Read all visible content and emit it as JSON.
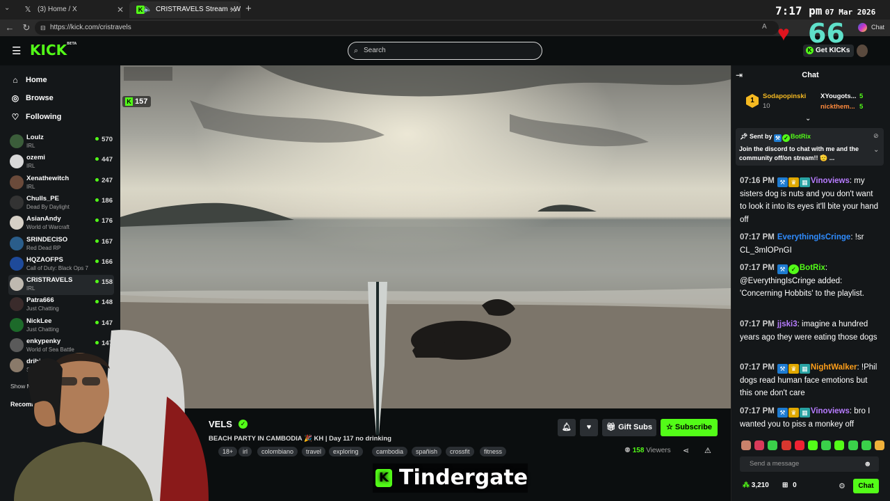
{
  "browser": {
    "tabs": [
      {
        "label": "(3) Home / X",
        "icon": "x-logo-icon"
      },
      {
        "label": "CRISTRAVELS Stream - Watch",
        "icon": "kick-logo-icon"
      }
    ],
    "url": "https://kick.com/cristravels",
    "clock": {
      "time": "7:17 pm",
      "date": "07 Mar 2026"
    },
    "chat_button": "Chat"
  },
  "overlay": {
    "heart_count": "66",
    "banner": "Tindergate"
  },
  "header": {
    "logo": "KICK",
    "logo_sup": "BETA",
    "search_placeholder": "Search",
    "get_kicks": "Get KICKs"
  },
  "sidebar": {
    "nav": [
      {
        "label": "Home",
        "icon": "home-icon"
      },
      {
        "label": "Browse",
        "icon": "compass-icon"
      },
      {
        "label": "Following",
        "icon": "heart-icon"
      }
    ],
    "channels": [
      {
        "name": "Loulz",
        "game": "IRL",
        "viewers": "570"
      },
      {
        "name": "ozemi",
        "game": "IRL",
        "viewers": "447"
      },
      {
        "name": "Xenathewitch",
        "game": "IRL",
        "viewers": "247"
      },
      {
        "name": "Chulls_PE",
        "game": "Dead By Daylight",
        "viewers": "186"
      },
      {
        "name": "AsianAndy",
        "game": "World of Warcraft",
        "viewers": "176"
      },
      {
        "name": "SRINDECISO",
        "game": "Red Dead RP",
        "viewers": "167"
      },
      {
        "name": "HQZAOFPS",
        "game": "Call of Duty: Black Ops 7",
        "viewers": "166"
      },
      {
        "name": "CRISTRAVELS",
        "game": "IRL",
        "viewers": "158"
      },
      {
        "name": "Patra666",
        "game": "Just Chatting",
        "viewers": "148"
      },
      {
        "name": "NickLee",
        "game": "Just Chatting",
        "viewers": "147"
      },
      {
        "name": "enkypenky",
        "game": "World of Sea Battle",
        "viewers": "147"
      },
      {
        "name": "dribina",
        "game": "Stumble Guys",
        "viewers": ""
      }
    ],
    "show_more": "Show More",
    "recommended": "Recommended"
  },
  "player": {
    "viewer_count": "157"
  },
  "stream": {
    "channel": "CRISTRAVELS",
    "channel_visible": "VELS",
    "title": "BEACH PARTY IN CAMBODIA 🎉 KH  | Day 117 no drinking",
    "tags": [
      "18+",
      "irl",
      "colombiano",
      "travel",
      "exploring",
      "cambodia",
      "spañish",
      "crossfit",
      "fitness"
    ],
    "viewers_count": "158",
    "viewers_label": "Viewers",
    "buttons": {
      "gift": "Gift Subs",
      "subscribe": "Subscribe"
    }
  },
  "chat": {
    "title": "Chat",
    "gifters": [
      {
        "name": "Sodapopinski",
        "count": "10",
        "rank": "1"
      },
      {
        "name": "XYougots...",
        "count": "5"
      },
      {
        "name": "nickthem...",
        "count": "5"
      }
    ],
    "pinned": {
      "sent_by_label": "Sent by",
      "sender": "BotRix",
      "text": "Join the discord to chat with me and the community off/on stream!! 🫡 ..."
    },
    "messages": [
      {
        "time": "07:16 PM",
        "user": "Vinoviews",
        "color": "#b77cff",
        "text": "my sisters dog is nuts and you don't want to look it into its eyes it'll bite your hand off"
      },
      {
        "time": "07:17 PM",
        "user": "EverythingIsCringe",
        "color": "#2f8cff",
        "text": "!sr CL_3mlOPnGI"
      },
      {
        "time": "07:17 PM",
        "user": "BotRix",
        "color": "#53fc18",
        "text": "@EverythingIsCringe added: 'Concerning Hobbits' to the playlist."
      },
      {
        "time": "07:17 PM",
        "user": "jjski3",
        "color": "#b77cff",
        "text": "imagine a hundred years ago they were eating those dogs"
      },
      {
        "time": "07:17 PM",
        "user": "NightWalker",
        "color": "#ff9f1a",
        "text": "!Phil dogs read human face emotions but this one don't care"
      },
      {
        "time": "07:17 PM",
        "user": "Vinoviews",
        "color": "#b77cff",
        "text": "bro I wanted you to piss a monkey off"
      }
    ],
    "input_placeholder": "Send a message",
    "points": "3,210",
    "gifts": "0",
    "send_button": "Chat"
  },
  "colors": {
    "accent": "#53fc18",
    "bg": "#0b0e0f",
    "panel": "#141719"
  }
}
